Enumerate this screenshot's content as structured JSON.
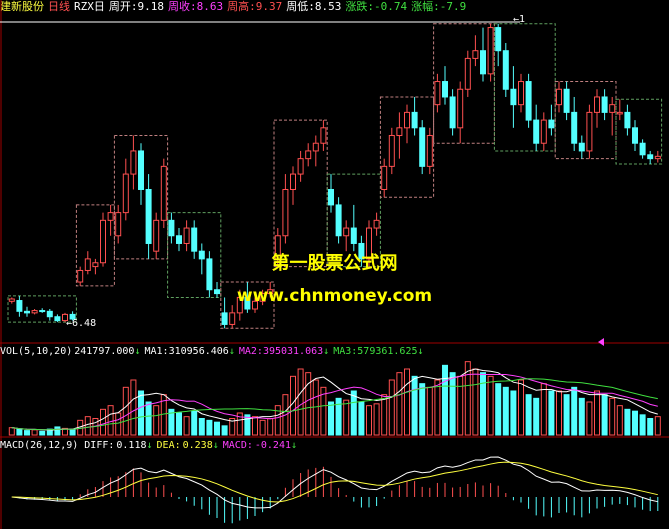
{
  "header": {
    "stock_name": "建新股份",
    "period": "日线",
    "indicator": "RZX日",
    "open": {
      "label": "周开:",
      "value": "9.18"
    },
    "close": {
      "label": "周收:",
      "value": "8.63"
    },
    "high": {
      "label": "周高:",
      "value": "9.37"
    },
    "low": {
      "label": "周低:",
      "value": "8.53"
    },
    "change": {
      "label": "涨跌:",
      "value": "-0.74"
    },
    "pct": {
      "label": "涨幅:",
      "value": "-7.9"
    }
  },
  "watermark": {
    "line1": "第一股票公式网",
    "line2": "www.chnmoney.com"
  },
  "colors": {
    "up": "#ff5050",
    "down": "#54ffff",
    "box_up": "#c08080",
    "box_down": "#60a060",
    "ma1": "#ffffff",
    "ma2": "#ff40ff",
    "ma3": "#40e040",
    "text_white": "#ffffff",
    "text_yellow": "#ffff40",
    "text_magenta": "#ff40ff",
    "text_green": "#40e040",
    "text_red": "#ff5050"
  },
  "chart_data": {
    "type": "candlestick",
    "price_labels": {
      "low": "6.48",
      "high": "1"
    },
    "weeks": [
      {
        "from": 0,
        "to": 8,
        "dir": "down"
      },
      {
        "from": 9,
        "to": 13,
        "dir": "up"
      },
      {
        "from": 14,
        "to": 20,
        "dir": "up"
      },
      {
        "from": 21,
        "to": 27,
        "dir": "down"
      },
      {
        "from": 28,
        "to": 34,
        "dir": "up"
      },
      {
        "from": 35,
        "to": 41,
        "dir": "up"
      },
      {
        "from": 42,
        "to": 48,
        "dir": "down"
      },
      {
        "from": 49,
        "to": 55,
        "dir": "up"
      },
      {
        "from": 56,
        "to": 63,
        "dir": "up"
      },
      {
        "from": 64,
        "to": 71,
        "dir": "down"
      },
      {
        "from": 72,
        "to": 79,
        "dir": "up"
      },
      {
        "from": 80,
        "to": 85,
        "dir": "down"
      }
    ],
    "candles": [
      [
        6.75,
        6.8,
        6.72,
        6.78
      ],
      [
        6.76,
        6.82,
        6.55,
        6.62
      ],
      [
        6.62,
        6.68,
        6.55,
        6.6
      ],
      [
        6.6,
        6.65,
        6.58,
        6.63
      ],
      [
        6.63,
        6.66,
        6.6,
        6.62
      ],
      [
        6.62,
        6.65,
        6.5,
        6.55
      ],
      [
        6.55,
        6.58,
        6.48,
        6.5
      ],
      [
        6.5,
        6.6,
        6.48,
        6.58
      ],
      [
        6.58,
        6.62,
        6.5,
        6.52
      ],
      [
        7.0,
        7.2,
        6.95,
        7.15
      ],
      [
        7.15,
        7.4,
        7.1,
        7.3
      ],
      [
        7.2,
        7.3,
        7.1,
        7.25
      ],
      [
        7.25,
        7.9,
        7.2,
        7.8
      ],
      [
        7.8,
        8.0,
        7.6,
        7.9
      ],
      [
        7.6,
        8.0,
        7.5,
        7.9
      ],
      [
        7.9,
        8.6,
        7.8,
        8.4
      ],
      [
        8.4,
        8.9,
        8.2,
        8.7
      ],
      [
        8.7,
        8.8,
        8.0,
        8.2
      ],
      [
        8.2,
        8.4,
        7.3,
        7.5
      ],
      [
        7.4,
        7.9,
        7.3,
        7.8
      ],
      [
        7.8,
        8.6,
        7.7,
        8.5
      ],
      [
        7.8,
        7.9,
        7.5,
        7.6
      ],
      [
        7.6,
        7.7,
        7.4,
        7.5
      ],
      [
        7.5,
        7.8,
        7.4,
        7.7
      ],
      [
        7.7,
        7.8,
        7.3,
        7.4
      ],
      [
        7.4,
        7.5,
        7.1,
        7.3
      ],
      [
        7.3,
        7.4,
        6.8,
        6.9
      ],
      [
        6.9,
        7.0,
        6.8,
        6.85
      ],
      [
        6.6,
        6.8,
        6.4,
        6.45
      ],
      [
        6.45,
        6.7,
        6.4,
        6.6
      ],
      [
        6.6,
        6.9,
        6.5,
        6.8
      ],
      [
        6.8,
        7.0,
        6.6,
        6.65
      ],
      [
        6.65,
        6.8,
        6.6,
        6.75
      ],
      [
        6.75,
        6.9,
        6.7,
        6.85
      ],
      [
        6.85,
        7.0,
        6.8,
        6.9
      ],
      [
        7.3,
        7.7,
        7.2,
        7.6
      ],
      [
        7.6,
        8.4,
        7.5,
        8.2
      ],
      [
        8.2,
        8.5,
        8.0,
        8.4
      ],
      [
        8.4,
        8.7,
        8.3,
        8.6
      ],
      [
        8.6,
        8.8,
        8.5,
        8.7
      ],
      [
        8.7,
        8.9,
        8.5,
        8.8
      ],
      [
        8.8,
        9.1,
        8.7,
        9.0
      ],
      [
        8.2,
        8.4,
        7.9,
        8.0
      ],
      [
        8.0,
        8.1,
        7.5,
        7.6
      ],
      [
        7.6,
        7.8,
        7.4,
        7.7
      ],
      [
        7.7,
        8.0,
        7.4,
        7.5
      ],
      [
        7.5,
        7.6,
        7.2,
        7.3
      ],
      [
        7.3,
        7.8,
        7.2,
        7.7
      ],
      [
        7.7,
        7.9,
        7.6,
        7.8
      ],
      [
        8.2,
        8.6,
        8.1,
        8.5
      ],
      [
        8.5,
        9.0,
        8.4,
        8.9
      ],
      [
        8.9,
        9.2,
        8.6,
        9.0
      ],
      [
        9.0,
        9.3,
        8.8,
        9.2
      ],
      [
        9.2,
        9.4,
        8.9,
        9.0
      ],
      [
        9.0,
        9.1,
        8.4,
        8.5
      ],
      [
        8.5,
        9.0,
        8.4,
        8.9
      ],
      [
        9.3,
        9.7,
        9.2,
        9.6
      ],
      [
        9.6,
        9.8,
        9.3,
        9.4
      ],
      [
        9.4,
        9.5,
        8.9,
        9.0
      ],
      [
        9.0,
        9.6,
        8.8,
        9.5
      ],
      [
        9.5,
        10.0,
        9.4,
        9.9
      ],
      [
        9.9,
        10.2,
        9.8,
        10.0
      ],
      [
        10.0,
        10.3,
        9.6,
        9.7
      ],
      [
        9.7,
        10.35,
        9.6,
        10.3
      ],
      [
        10.3,
        10.35,
        9.8,
        10.0
      ],
      [
        10.0,
        10.1,
        9.4,
        9.5
      ],
      [
        9.5,
        9.8,
        9.0,
        9.3
      ],
      [
        9.3,
        9.7,
        9.2,
        9.6
      ],
      [
        9.6,
        9.7,
        9.0,
        9.1
      ],
      [
        9.1,
        9.3,
        8.7,
        8.8
      ],
      [
        8.8,
        9.2,
        8.7,
        9.1
      ],
      [
        9.1,
        9.3,
        8.9,
        9.0
      ],
      [
        9.3,
        9.6,
        9.2,
        9.5
      ],
      [
        9.5,
        9.6,
        9.1,
        9.2
      ],
      [
        9.2,
        9.4,
        8.7,
        8.8
      ],
      [
        8.8,
        8.9,
        8.6,
        8.7
      ],
      [
        8.7,
        9.3,
        8.6,
        9.2
      ],
      [
        9.2,
        9.5,
        9.0,
        9.4
      ],
      [
        9.4,
        9.5,
        9.1,
        9.2
      ],
      [
        9.2,
        9.4,
        8.9,
        9.3
      ],
      [
        9.18,
        9.37,
        9.1,
        9.2
      ],
      [
        9.2,
        9.3,
        8.9,
        9.0
      ],
      [
        9.0,
        9.1,
        8.7,
        8.8
      ],
      [
        8.8,
        8.85,
        8.6,
        8.65
      ],
      [
        8.65,
        8.7,
        8.53,
        8.6
      ],
      [
        8.6,
        8.7,
        8.55,
        8.63
      ]
    ],
    "ylim": [
      6.3,
      10.45
    ],
    "volume": {
      "label": "VOL(5,10,20)",
      "vol": {
        "text": "241797.000",
        "arrow": "↓"
      },
      "ma1": {
        "label": "MA1:",
        "value": "310956.406",
        "arrow": "↓"
      },
      "ma2": {
        "label": "MA2:",
        "value": "395031.063",
        "arrow": "↓"
      },
      "ma3": {
        "label": "MA3:",
        "value": "579361.625",
        "arrow": "↓"
      },
      "values": [
        20,
        15,
        12,
        14,
        10,
        16,
        22,
        18,
        15,
        40,
        50,
        45,
        70,
        80,
        60,
        130,
        150,
        120,
        90,
        80,
        110,
        70,
        60,
        50,
        65,
        45,
        40,
        35,
        25,
        45,
        60,
        55,
        50,
        40,
        45,
        80,
        110,
        160,
        180,
        170,
        150,
        130,
        90,
        100,
        95,
        120,
        90,
        80,
        85,
        110,
        150,
        170,
        180,
        160,
        140,
        130,
        150,
        190,
        170,
        160,
        200,
        180,
        170,
        160,
        140,
        130,
        120,
        150,
        110,
        100,
        140,
        120,
        120,
        110,
        130,
        100,
        90,
        120,
        110,
        100,
        80,
        70,
        65,
        55,
        45,
        50
      ]
    },
    "macd": {
      "label": "MACD(26,12,9)",
      "diff": {
        "label": "DIFF:",
        "value": "0.118",
        "arrow": "↓"
      },
      "dea": {
        "label": "DEA:",
        "value": "0.238",
        "arrow": "↓"
      },
      "macd": {
        "label": "MACD:",
        "value": "-0.241",
        "arrow": "↓"
      }
    }
  }
}
